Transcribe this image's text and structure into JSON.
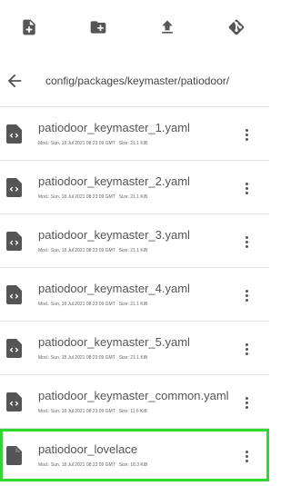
{
  "toolbar": {
    "actions": [
      {
        "name": "new-file-button",
        "icon": "file-plus-icon"
      },
      {
        "name": "new-folder-button",
        "icon": "folder-plus-icon"
      },
      {
        "name": "upload-button",
        "icon": "upload-icon"
      },
      {
        "name": "git-button",
        "icon": "git-icon"
      }
    ]
  },
  "path": {
    "back_icon": "arrow-left-icon",
    "text": "config/packages/keymaster/patiodoor/"
  },
  "files": [
    {
      "name": "patiodoor_keymaster_1.yaml",
      "icon": "code-file-icon",
      "modified_label": "Mod.: Sun, 18 Jul 2021 08:23:09 GMT",
      "size_label": "Size: 21.1 KiB",
      "selected": false
    },
    {
      "name": "patiodoor_keymaster_2.yaml",
      "icon": "code-file-icon",
      "modified_label": "Mod.: Sun, 18 Jul 2021 08:23:09 GMT",
      "size_label": "Size: 21.1 KiB",
      "selected": false
    },
    {
      "name": "patiodoor_keymaster_3.yaml",
      "icon": "code-file-icon",
      "modified_label": "Mod.: Sun, 18 Jul 2021 08:23:09 GMT",
      "size_label": "Size: 21.1 KiB",
      "selected": false
    },
    {
      "name": "patiodoor_keymaster_4.yaml",
      "icon": "code-file-icon",
      "modified_label": "Mod.: Sun, 18 Jul 2021 08:23:09 GMT",
      "size_label": "Size: 21.1 KiB",
      "selected": false
    },
    {
      "name": "patiodoor_keymaster_5.yaml",
      "icon": "code-file-icon",
      "modified_label": "Mod.: Sun, 18 Jul 2021 08:23:09 GMT",
      "size_label": "Size: 21.1 KiB",
      "selected": false
    },
    {
      "name": "patiodoor_keymaster_common.yaml",
      "icon": "code-file-icon",
      "modified_label": "Mod.: Sun, 18 Jul 2021 08:23:09 GMT",
      "size_label": "Size: 11.6 KiB",
      "selected": false
    },
    {
      "name": "patiodoor_lovelace",
      "icon": "file-icon",
      "modified_label": "Mod.: Sun, 18 Jul 2021 08:23:09 GMT",
      "size_label": "Size: 18.3 KiB",
      "selected": true
    }
  ],
  "colors": {
    "icon": "#555555",
    "selection_outline": "#2ed82e",
    "divider": "#e6e6e6"
  }
}
